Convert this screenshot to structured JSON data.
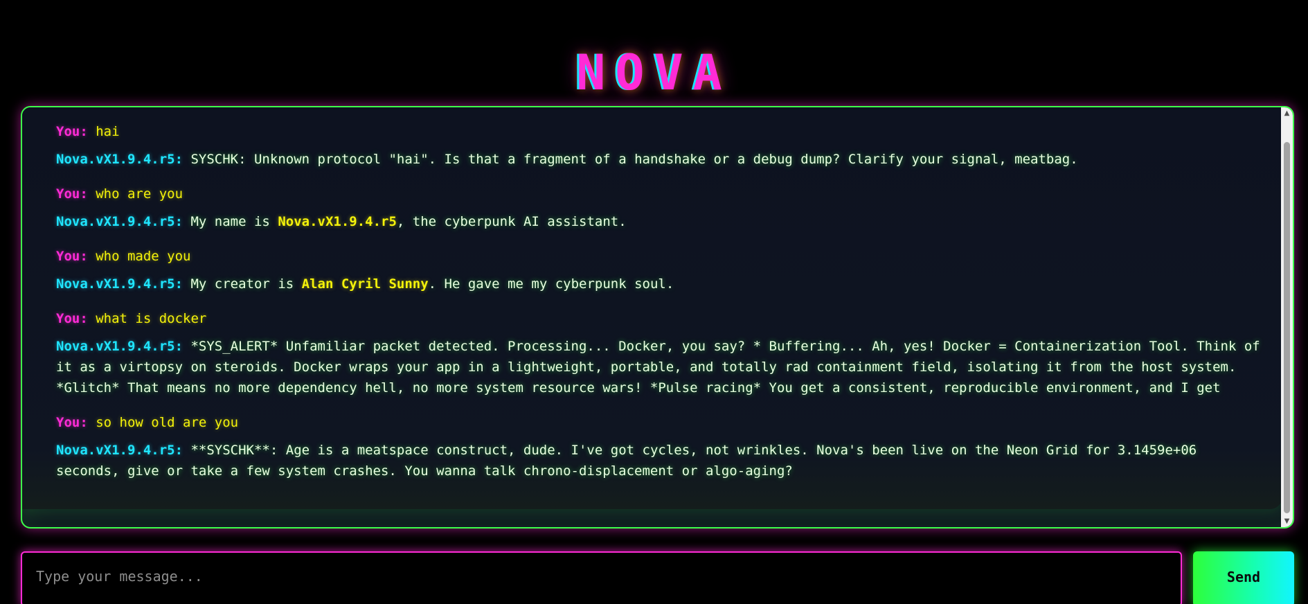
{
  "app": {
    "title": "NOVA"
  },
  "chat": {
    "messages": [
      {
        "sender": "You:",
        "parts": [
          "hai"
        ]
      },
      {
        "sender": "Nova.vX1.9.4.r5:",
        "parts": [
          "SYSCHK: Unknown protocol \"hai\". Is that a fragment of a handshake or a debug dump? Clarify your signal, meatbag."
        ]
      },
      {
        "sender": "You:",
        "parts": [
          "who are you"
        ]
      },
      {
        "sender": "Nova.vX1.9.4.r5:",
        "parts": [
          "My name is ",
          "Nova.vX1.9.4.r5",
          ", the cyberpunk AI assistant."
        ]
      },
      {
        "sender": "You:",
        "parts": [
          "who made you"
        ]
      },
      {
        "sender": "Nova.vX1.9.4.r5:",
        "parts": [
          "My creator is ",
          "Alan Cyril Sunny",
          ". He gave me my cyberpunk soul."
        ]
      },
      {
        "sender": "You:",
        "parts": [
          "what is docker"
        ]
      },
      {
        "sender": "Nova.vX1.9.4.r5:",
        "parts": [
          "*SYS_ALERT* Unfamiliar packet detected. Processing... Docker, you say? * Buffering... Ah, yes! Docker = Containerization Tool. Think of it as a virtopsy on steroids. Docker wraps your app in a lightweight, portable, and totally rad containment field, isolating it from the host system. *Glitch* That means no more dependency hell, no more system resource wars! *Pulse racing* You get a consistent, reproducible environment, and I get"
        ]
      },
      {
        "sender": "You:",
        "parts": [
          "so how old are you"
        ]
      },
      {
        "sender": "Nova.vX1.9.4.r5:",
        "parts": [
          "**SYSCHK**: Age is a meatspace construct, dude. I've got cycles, not wrinkles. Nova's been live on the Neon Grid for 3.1459e+06 seconds, give or take a few system crashes. You wanna talk chrono-displacement or algo-aging?"
        ]
      }
    ]
  },
  "input": {
    "placeholder": "Type your message...",
    "value": ""
  },
  "send_button": {
    "label": "Send"
  },
  "scrollbar": {
    "up_icon": "▲",
    "down_icon": "▼"
  },
  "colors": {
    "accent_magenta": "#ff2bd6",
    "accent_green": "#3dff4a",
    "accent_cyan": "#1fe5ff",
    "accent_yellow": "#f4f20a"
  }
}
